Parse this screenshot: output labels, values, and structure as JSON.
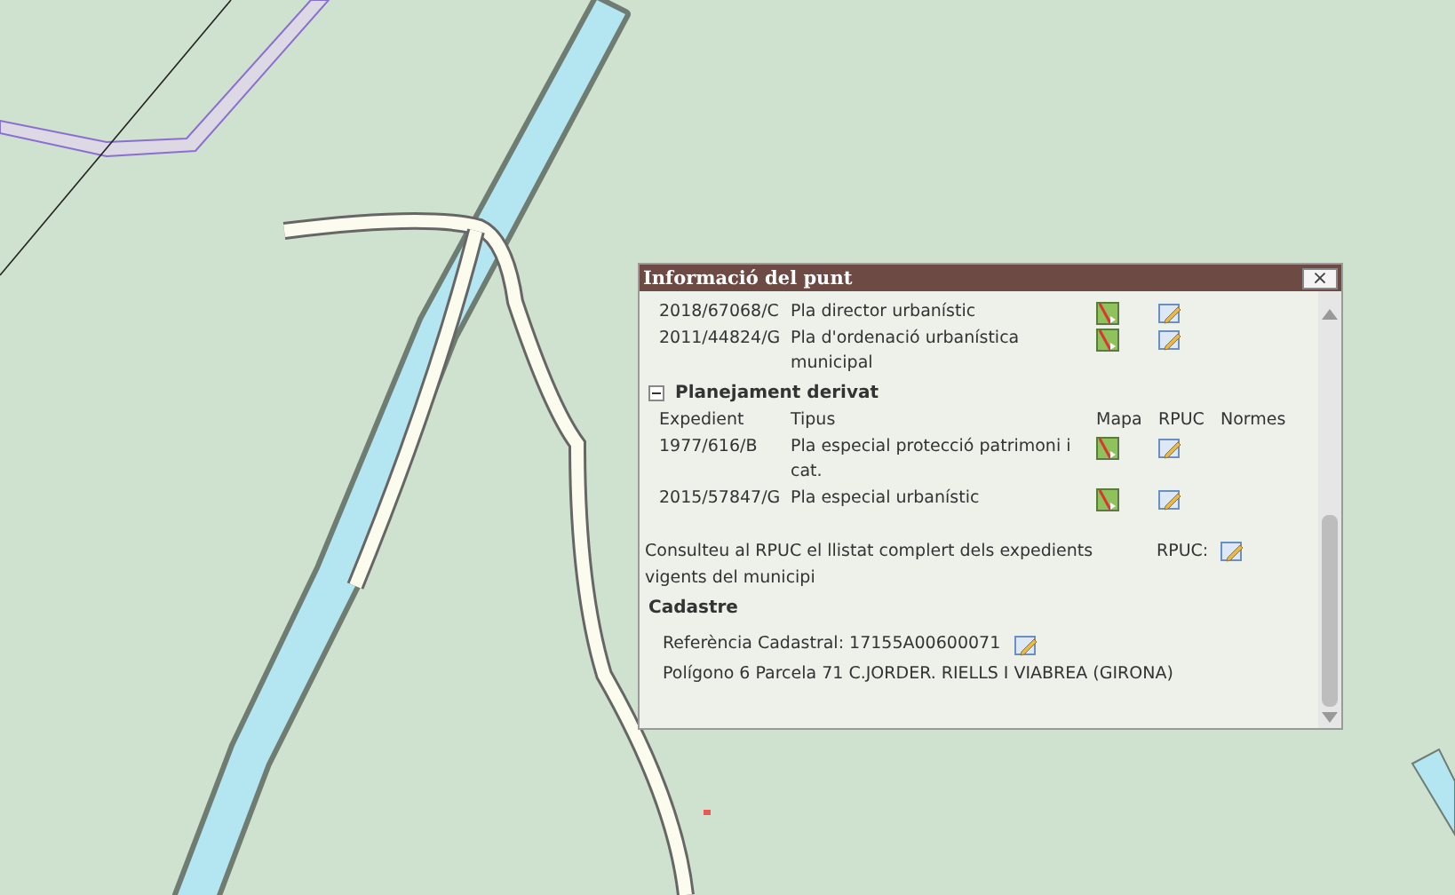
{
  "popup": {
    "title": "Informació del punt",
    "close": "×",
    "plans": [
      {
        "expedient": "2018/67068/C",
        "tipus": "Pla director urbanístic"
      },
      {
        "expedient": "2011/44824/G",
        "tipus": "Pla d'ordenació urbanística municipal"
      }
    ],
    "derivat": {
      "title": "Planejament derivat",
      "expanded": true,
      "columns": [
        "Expedient",
        "Tipus",
        "Mapa",
        "RPUC",
        "Normes"
      ],
      "rows": [
        {
          "expedient": "1977/616/B",
          "tipus": "Pla especial protecció patrimoni i cat."
        },
        {
          "expedient": "2015/57847/G",
          "tipus": "Pla especial urbanístic"
        }
      ]
    },
    "note": "Consulteu al RPUC el llistat complert dels expedients vigents del municipi",
    "rpuc_label": "RPUC:",
    "cadastre": {
      "title": "Cadastre",
      "reference": "Referència Cadastral: 17155A00600071",
      "parcel": "Polígono 6 Parcela 71 C.JORDER. RIELLS I VIABREA (GIRONA)"
    }
  }
}
